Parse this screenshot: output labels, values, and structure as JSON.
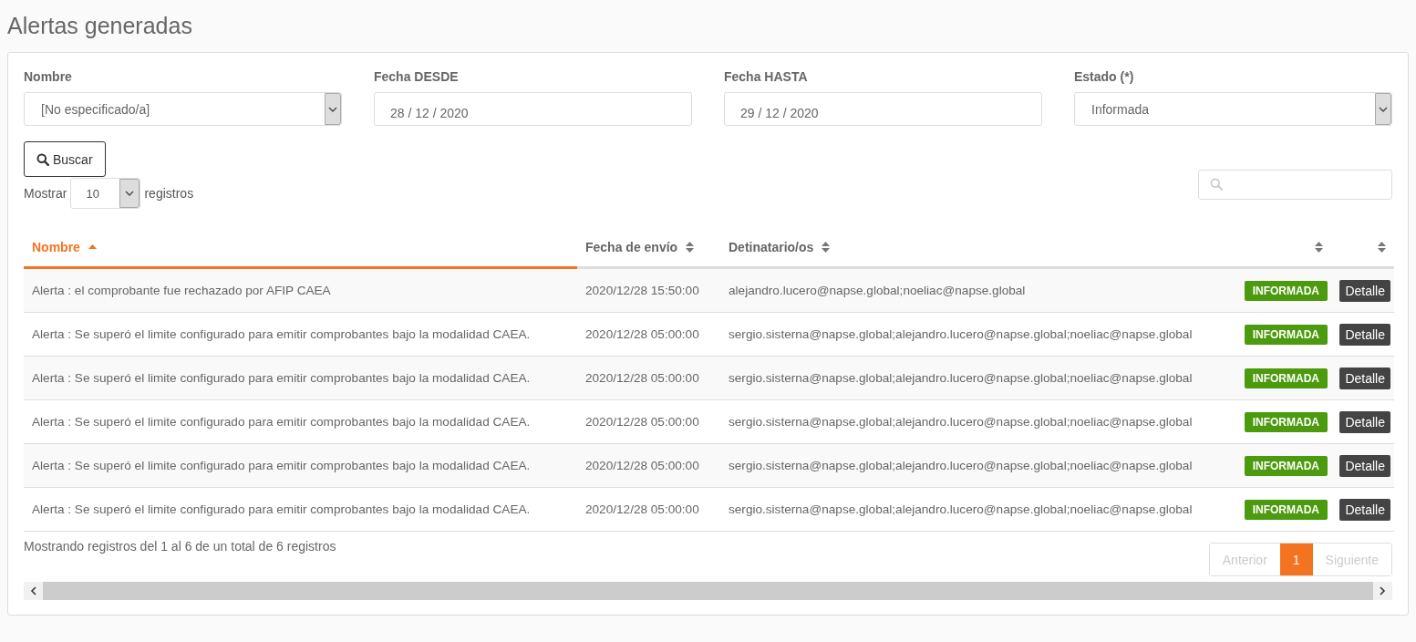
{
  "page_title": "Alertas generadas",
  "filters": [
    {
      "label": "Nombre",
      "kind": "select",
      "value": "[No especificado/a]"
    },
    {
      "label": "Fecha DESDE",
      "kind": "date",
      "value": "28 / 12 / 2020"
    },
    {
      "label": "Fecha HASTA",
      "kind": "date",
      "value": "29 / 12 / 2020"
    },
    {
      "label": "Estado (*)",
      "kind": "select",
      "value": "Informada"
    }
  ],
  "search_button": "Buscar",
  "page_length": {
    "prefix": "Mostrar",
    "value": "10",
    "suffix": "registros"
  },
  "table": {
    "columns": [
      {
        "label": "Nombre",
        "sorted": true
      },
      {
        "label": "Fecha de envío",
        "sorted": false
      },
      {
        "label": "Detinatario/os",
        "sorted": false
      },
      {
        "sorted": false
      },
      {
        "sorted": false
      }
    ],
    "rows": [
      {
        "name": "Alerta : el comprobante fue rechazado por AFIP CAEA",
        "date": "2020/12/28 15:50:00",
        "recipients": "alejandro.lucero@napse.global;noeliac@napse.global",
        "status": "INFORMADA",
        "action": "Detalle"
      },
      {
        "name": "Alerta : Se superó el limite configurado para emitir comprobantes bajo la modalidad CAEA.",
        "date": "2020/12/28 05:00:00",
        "recipients": "sergio.sisterna@napse.global;alejandro.lucero@napse.global;noeliac@napse.global",
        "status": "INFORMADA",
        "action": "Detalle"
      },
      {
        "name": "Alerta : Se superó el limite configurado para emitir comprobantes bajo la modalidad CAEA.",
        "date": "2020/12/28 05:00:00",
        "recipients": "sergio.sisterna@napse.global;alejandro.lucero@napse.global;noeliac@napse.global",
        "status": "INFORMADA",
        "action": "Detalle"
      },
      {
        "name": "Alerta : Se superó el limite configurado para emitir comprobantes bajo la modalidad CAEA.",
        "date": "2020/12/28 05:00:00",
        "recipients": "sergio.sisterna@napse.global;alejandro.lucero@napse.global;noeliac@napse.global",
        "status": "INFORMADA",
        "action": "Detalle"
      },
      {
        "name": "Alerta : Se superó el limite configurado para emitir comprobantes bajo la modalidad CAEA.",
        "date": "2020/12/28 05:00:00",
        "recipients": "sergio.sisterna@napse.global;alejandro.lucero@napse.global;noeliac@napse.global",
        "status": "INFORMADA",
        "action": "Detalle"
      },
      {
        "name": "Alerta : Se superó el limite configurado para emitir comprobantes bajo la modalidad CAEA.",
        "date": "2020/12/28 05:00:00",
        "recipients": "sergio.sisterna@napse.global;alejandro.lucero@napse.global;noeliac@napse.global",
        "status": "INFORMADA",
        "action": "Detalle"
      }
    ]
  },
  "info": "Mostrando registros del 1 al 6 de un total de 6 registros",
  "pagination": {
    "previous": {
      "label": "Anterior",
      "disabled": true
    },
    "pages": [
      {
        "label": "1",
        "selected": true
      }
    ],
    "next": {
      "label": "Siguiente",
      "disabled": true
    }
  }
}
